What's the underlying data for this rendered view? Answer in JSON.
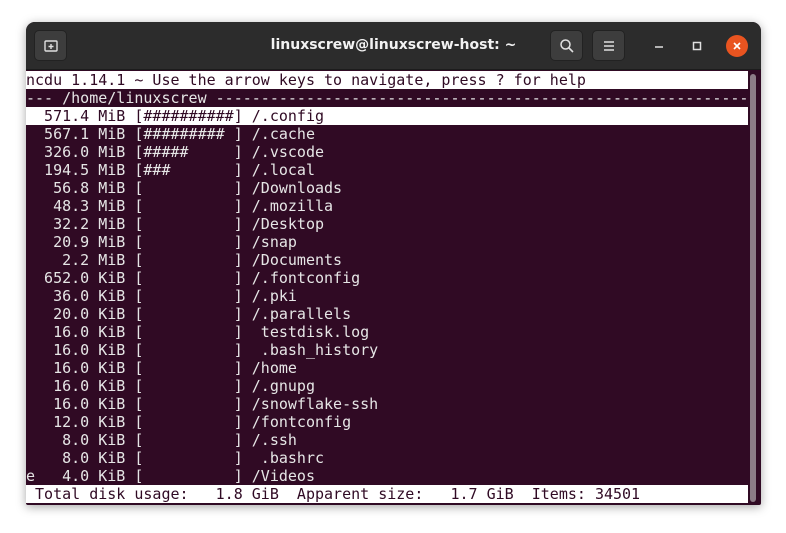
{
  "window": {
    "title": "linuxscrew@linuxscrew-host: ~"
  },
  "ncdu": {
    "header": "ncdu 1.14.1 ~ Use the arrow keys to navigate, press ? for help",
    "path_line": "--- /home/linuxscrew -----------------------------------------------------------",
    "entries": [
      "  571.4 MiB [##########] /.config",
      "  567.1 MiB [######### ] /.cache",
      "  326.0 MiB [#####     ] /.vscode",
      "  194.5 MiB [###       ] /.local",
      "   56.8 MiB [          ] /Downloads",
      "   48.3 MiB [          ] /.mozilla",
      "   32.2 MiB [          ] /Desktop",
      "   20.9 MiB [          ] /snap",
      "    2.2 MiB [          ] /Documents",
      "  652.0 KiB [          ] /.fontconfig",
      "   36.0 KiB [          ] /.pki",
      "   20.0 KiB [          ] /.parallels",
      "   16.0 KiB [          ]  testdisk.log",
      "   16.0 KiB [          ]  .bash_history",
      "   16.0 KiB [          ] /home",
      "   16.0 KiB [          ] /.gnupg",
      "   16.0 KiB [          ] /snowflake-ssh",
      "   12.0 KiB [          ] /fontconfig",
      "    8.0 KiB [          ] /.ssh",
      "    8.0 KiB [          ]  .bashrc",
      "e   4.0 KiB [          ] /Videos"
    ],
    "status": " Total disk usage:   1.8 GiB  Apparent size:   1.7 GiB  Items: 34501"
  }
}
